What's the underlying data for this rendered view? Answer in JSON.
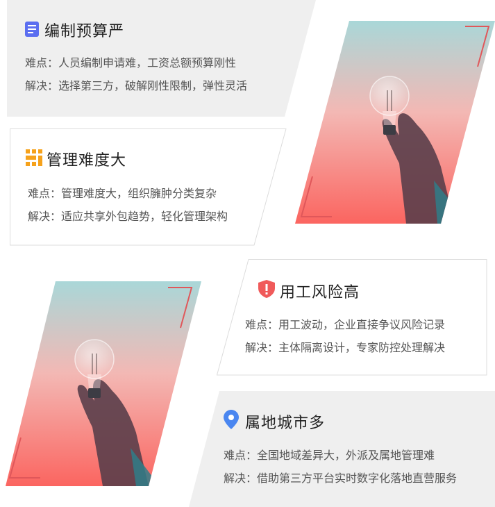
{
  "cards": [
    {
      "title": "编制预算严",
      "difficulty": "难点：人员编制申请难，工资总额预算刚性",
      "solution": "解决：选择第三方，破解刚性限制，弹性灵活",
      "icon": "document-icon",
      "icon_color": "#5b6ef0"
    },
    {
      "title": "管理难度大",
      "difficulty": "难点：管理难度大，组织臃肿分类复杂",
      "solution": "解决：适应共享外包趋势，轻化管理架构",
      "icon": "grid-icon",
      "icon_color": "#f6a21c"
    },
    {
      "title": "用工风险高",
      "difficulty": "难点：用工波动，企业直接争议风险记录",
      "solution": "解决：主体隔离设计，专家防控处理解决",
      "icon": "shield-alert-icon",
      "icon_color": "#f05a5a"
    },
    {
      "title": "属地城市多",
      "difficulty": "难点：全国地域差异大，外派及属地管理难",
      "solution": "解决：借助第三方平台实时数字化落地直营服务",
      "icon": "location-pin-icon",
      "icon_color": "#4a86f0"
    }
  ],
  "photos": [
    "lightbulb-in-hand-photo",
    "lightbulb-in-hand-photo"
  ],
  "colors": {
    "card_gray": "#efefef",
    "card_border": "#dcdcdc",
    "accent_line": "#e0575a",
    "gradient_top": "#a9d6d6",
    "gradient_bottom": "#fb6b66"
  }
}
